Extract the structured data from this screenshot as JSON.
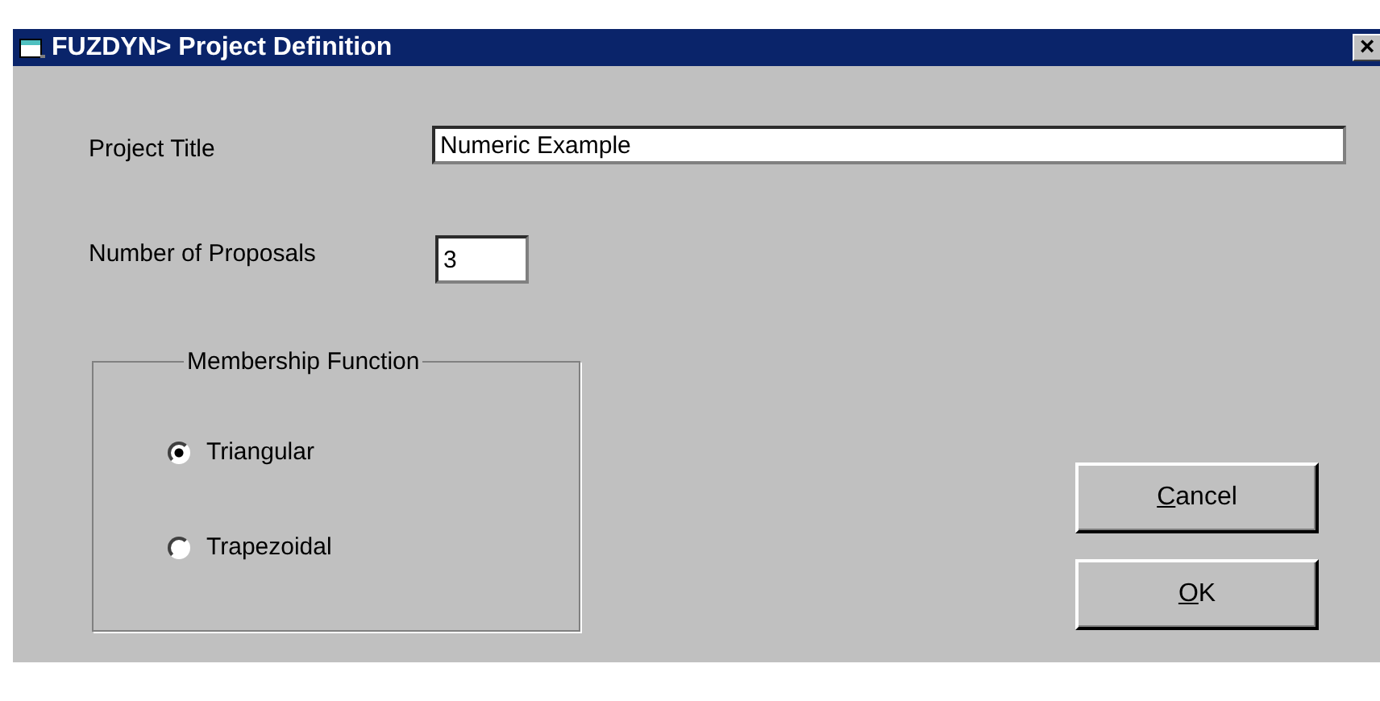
{
  "window": {
    "title": "FUZDYN> Project Definition",
    "close": "×"
  },
  "fields": [
    {
      "label": "Project Title",
      "value": "Numeric Example",
      "kind": "wide"
    },
    {
      "label": "Number of Proposals",
      "value": "3",
      "kind": "narrow"
    }
  ],
  "membership_function": {
    "title": "Membership Function",
    "options": [
      {
        "label": "Triangular",
        "selected": true
      },
      {
        "label": "Trapezoidal",
        "selected": false
      }
    ]
  },
  "buttons": [
    "Cancel",
    "OK"
  ]
}
